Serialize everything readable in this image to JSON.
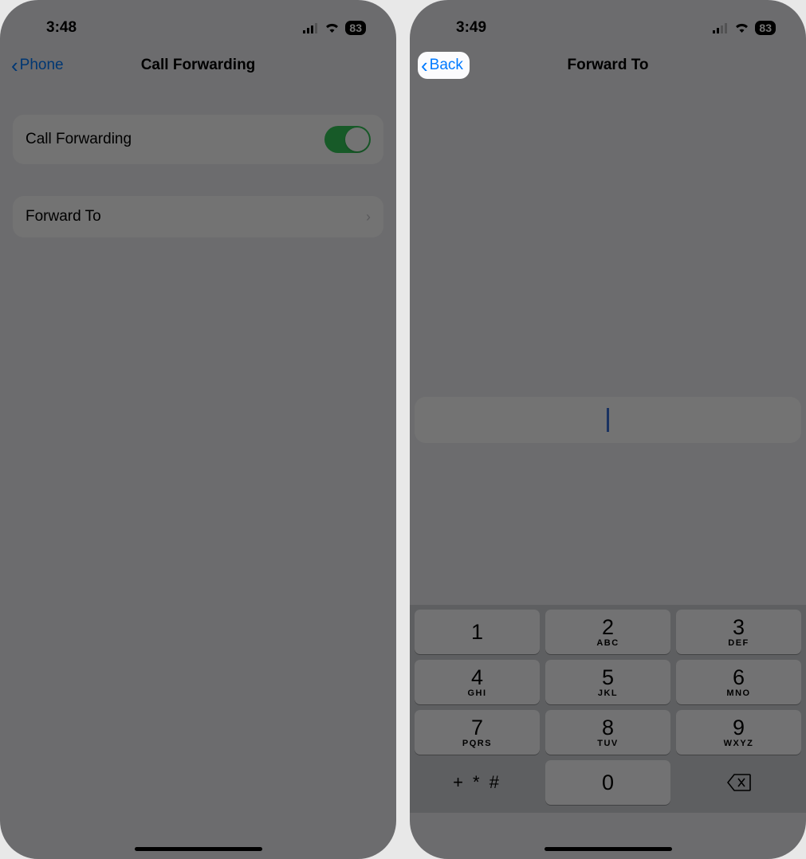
{
  "left": {
    "status": {
      "time": "3:48",
      "battery": "83"
    },
    "nav": {
      "back": "Phone",
      "title": "Call Forwarding"
    },
    "rows": {
      "call_forwarding": "Call Forwarding",
      "forward_to": "Forward To"
    }
  },
  "right": {
    "status": {
      "time": "3:49",
      "battery": "83"
    },
    "nav": {
      "back": "Back",
      "title": "Forward To"
    },
    "keypad": [
      {
        "digit": "1",
        "letters": ""
      },
      {
        "digit": "2",
        "letters": "ABC"
      },
      {
        "digit": "3",
        "letters": "DEF"
      },
      {
        "digit": "4",
        "letters": "GHI"
      },
      {
        "digit": "5",
        "letters": "JKL"
      },
      {
        "digit": "6",
        "letters": "MNO"
      },
      {
        "digit": "7",
        "letters": "PQRS"
      },
      {
        "digit": "8",
        "letters": "TUV"
      },
      {
        "digit": "9",
        "letters": "WXYZ"
      },
      {
        "digit": "+ * #",
        "letters": ""
      },
      {
        "digit": "0",
        "letters": ""
      }
    ]
  }
}
